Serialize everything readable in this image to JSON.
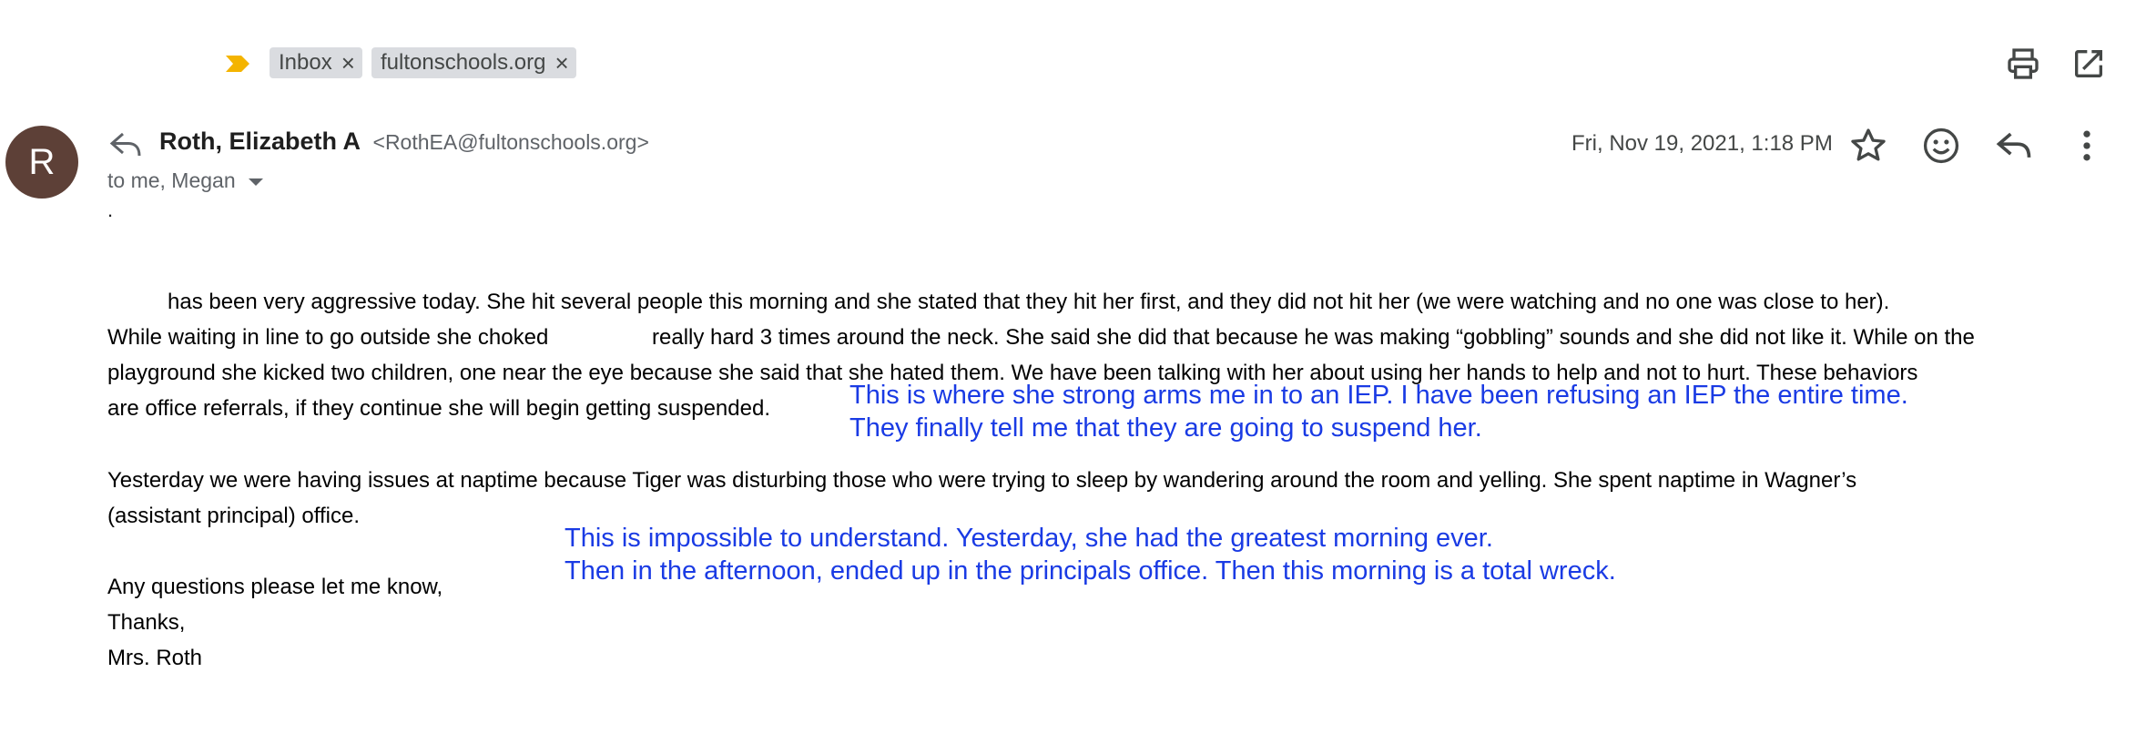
{
  "labels": {
    "chips": [
      {
        "label": "Inbox"
      },
      {
        "label": "fultonschools.org"
      }
    ],
    "remove_glyph": "×"
  },
  "toolbar": {
    "print_icon": "print-icon",
    "open_in_new_icon": "open-in-new-window-icon"
  },
  "header": {
    "avatar_letter": "R",
    "sender_name": "Roth, Elizabeth A",
    "sender_email": "<RothEA@fultonschools.org>",
    "recipients": "to me, Megan",
    "date": "Fri, Nov 19, 2021, 1:18 PM",
    "icons": [
      "star-icon",
      "emoji-icon",
      "reply-icon",
      "more-vert-icon"
    ]
  },
  "email": {
    "dot": ".",
    "p1_lines": [
      "has been very aggressive today.  She hit several people this morning and she stated that they hit her first, and they did not hit her (we were watching and no one was close to her).",
      "While waiting in line to go outside she choked",
      "really hard 3 times around the neck.  She said she did that because he was making “gobbling” sounds and she did not like it.  While on the",
      "playground she kicked two children, one near the eye because she said that she hated them.  We have been talking with her about using her hands to help and not to hurt. These behaviors",
      "are office referrals, if they continue she will begin getting suspended."
    ],
    "p2_lines": [
      "Yesterday we were having issues at naptime because Tiger was disturbing those who were trying to sleep by wandering around the room and yelling.  She spent naptime in Wagner’s",
      "(assistant principal) office."
    ],
    "closing": [
      "Any questions please let me know,",
      "Thanks,",
      "Mrs. Roth"
    ]
  },
  "annotations": {
    "note1": [
      "This is where she strong arms me in to an IEP.  I have been refusing an IEP the entire time.",
      "They finally tell me that they are going to suspend her."
    ],
    "note2": [
      "This is impossible to understand.  Yesterday, she had the greatest morning ever.",
      "Then in the afternoon, ended up in the principals office.  Then this morning is a total wreck."
    ]
  }
}
